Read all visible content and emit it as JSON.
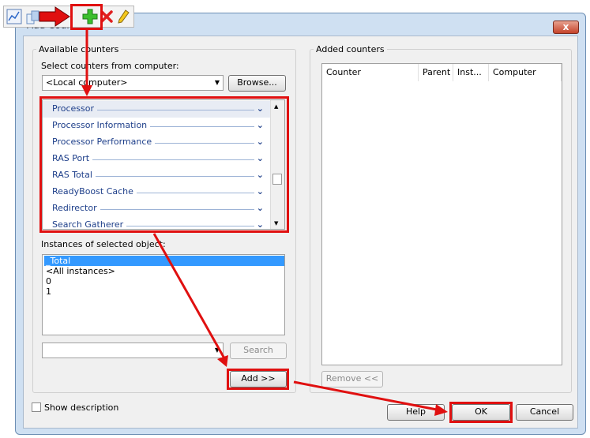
{
  "dialog": {
    "title": "Add Counters",
    "close_label": "x"
  },
  "toolbar": {
    "icons": [
      "chart-view-icon",
      "copy-icon",
      "add-counter-icon",
      "delete-icon",
      "highlight-icon"
    ]
  },
  "available": {
    "group_label": "Available counters",
    "computer_label": "Select counters from computer:",
    "computer_value": "<Local computer>",
    "browse_label": "Browse...",
    "counters": [
      {
        "label": "Processor",
        "selected": true
      },
      {
        "label": "Processor Information",
        "selected": false
      },
      {
        "label": "Processor Performance",
        "selected": false
      },
      {
        "label": "RAS Port",
        "selected": false
      },
      {
        "label": "RAS Total",
        "selected": false
      },
      {
        "label": "ReadyBoost Cache",
        "selected": false
      },
      {
        "label": "Redirector",
        "selected": false
      },
      {
        "label": "Search Gatherer",
        "selected": false
      }
    ],
    "instances_label": "Instances of selected object:",
    "instances": [
      {
        "label": "_Total",
        "selected": true
      },
      {
        "label": "<All instances>",
        "selected": false
      },
      {
        "label": "0",
        "selected": false
      },
      {
        "label": "1",
        "selected": false
      }
    ],
    "search_value": "",
    "search_label": "Search",
    "add_label": "Add >>"
  },
  "added": {
    "group_label": "Added counters",
    "columns": [
      "Counter",
      "Parent",
      "Inst...",
      "Computer"
    ],
    "remove_label": "Remove <<"
  },
  "footer": {
    "show_description_label": "Show description",
    "help_label": "Help",
    "ok_label": "OK",
    "cancel_label": "Cancel"
  },
  "colors": {
    "annotation": "#e01010",
    "selection": "#3399ff",
    "counter_text": "#1e3f8a"
  }
}
